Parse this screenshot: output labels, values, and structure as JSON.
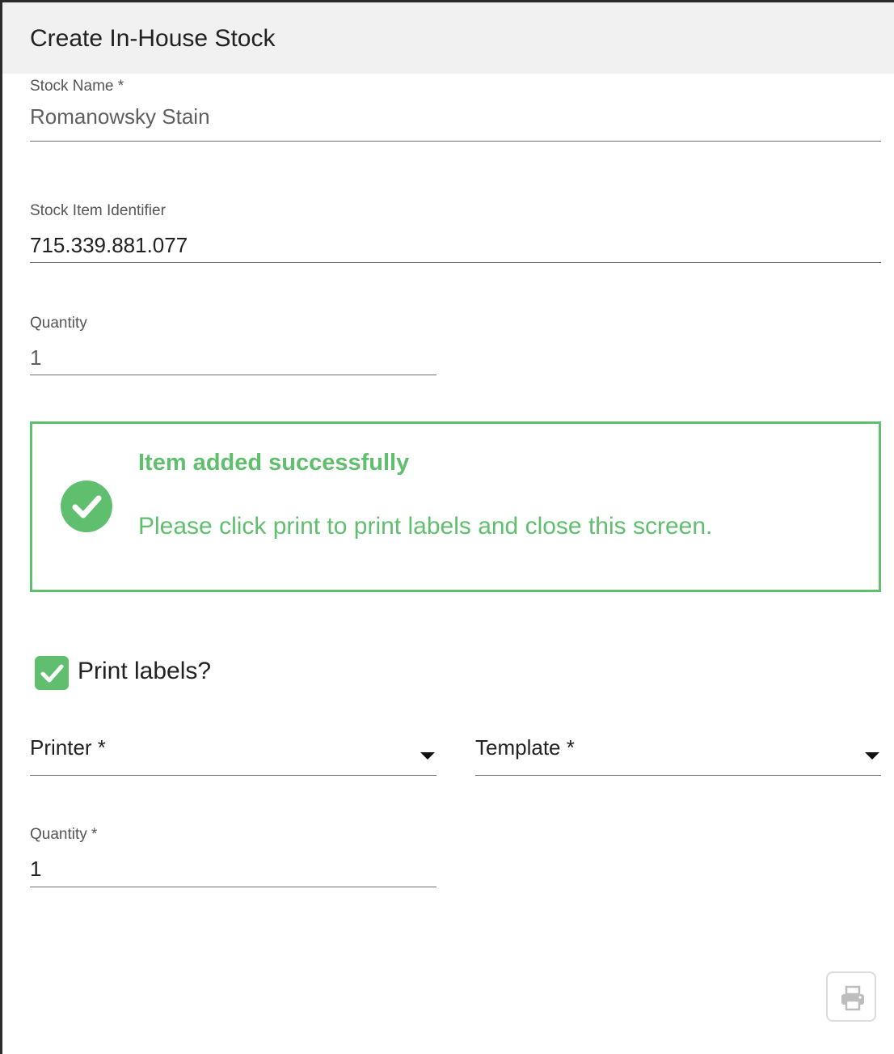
{
  "dialog": {
    "title": "Create In-House Stock"
  },
  "stock_name": {
    "label": "Stock Name *",
    "value": "Romanowsky Stain"
  },
  "stock_item_identifier": {
    "label": "Stock Item Identifier",
    "value": "715.339.881.077"
  },
  "quantity": {
    "label": "Quantity",
    "value": "1"
  },
  "alert": {
    "title": "Item added successfully",
    "message": "Please click print to print labels and close this screen.",
    "icon": "check-circle-icon",
    "color": "#5fbf6e"
  },
  "print_labels": {
    "label": "Print labels?",
    "checked": true
  },
  "printer": {
    "label": "Printer *"
  },
  "template": {
    "label": "Template *"
  },
  "label_quantity": {
    "label": "Quantity *",
    "value": "1"
  },
  "print_button": {
    "icon": "printer-icon",
    "disabled": true
  }
}
